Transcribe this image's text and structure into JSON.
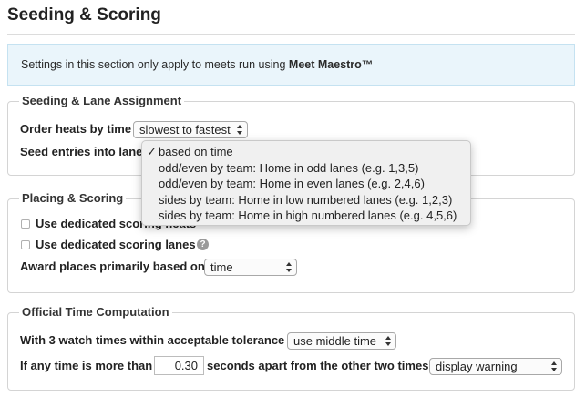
{
  "page_title": "Seeding & Scoring",
  "notice": {
    "text": "Settings in this section only apply to meets run using ",
    "emphasis": "Meet Maestro™"
  },
  "seeding": {
    "legend": "Seeding & Lane Assignment",
    "order_label": "Order heats by time",
    "order_value": "slowest to fastest",
    "seed_label": "Seed entries into lanes",
    "seed_options": [
      "based on time",
      "odd/even by team: Home in odd lanes (e.g. 1,3,5)",
      "odd/even by team: Home in even lanes (e.g. 2,4,6)",
      "sides by team: Home in low numbered lanes (e.g. 1,2,3)",
      "sides by team: Home in high numbered lanes (e.g. 4,5,6)"
    ],
    "seed_selected_check": "✓"
  },
  "placing": {
    "legend": "Placing & Scoring",
    "heats_label": "Use dedicated scoring heats",
    "lanes_label": "Use dedicated scoring lanes",
    "help_glyph": "?",
    "award_label": "Award places primarily based on",
    "award_value": "time"
  },
  "official": {
    "legend": "Official Time Computation",
    "watch_label": "With 3 watch times within acceptable tolerance",
    "watch_value": "use middle time",
    "diff_label_before": "If any time is more than",
    "diff_value": "0.30",
    "diff_label_after": "seconds apart from the other two times",
    "diff_action": "display warning"
  },
  "colors": {
    "notice_background": "#eaf5fb",
    "notice_border": "#c5e2f1"
  }
}
